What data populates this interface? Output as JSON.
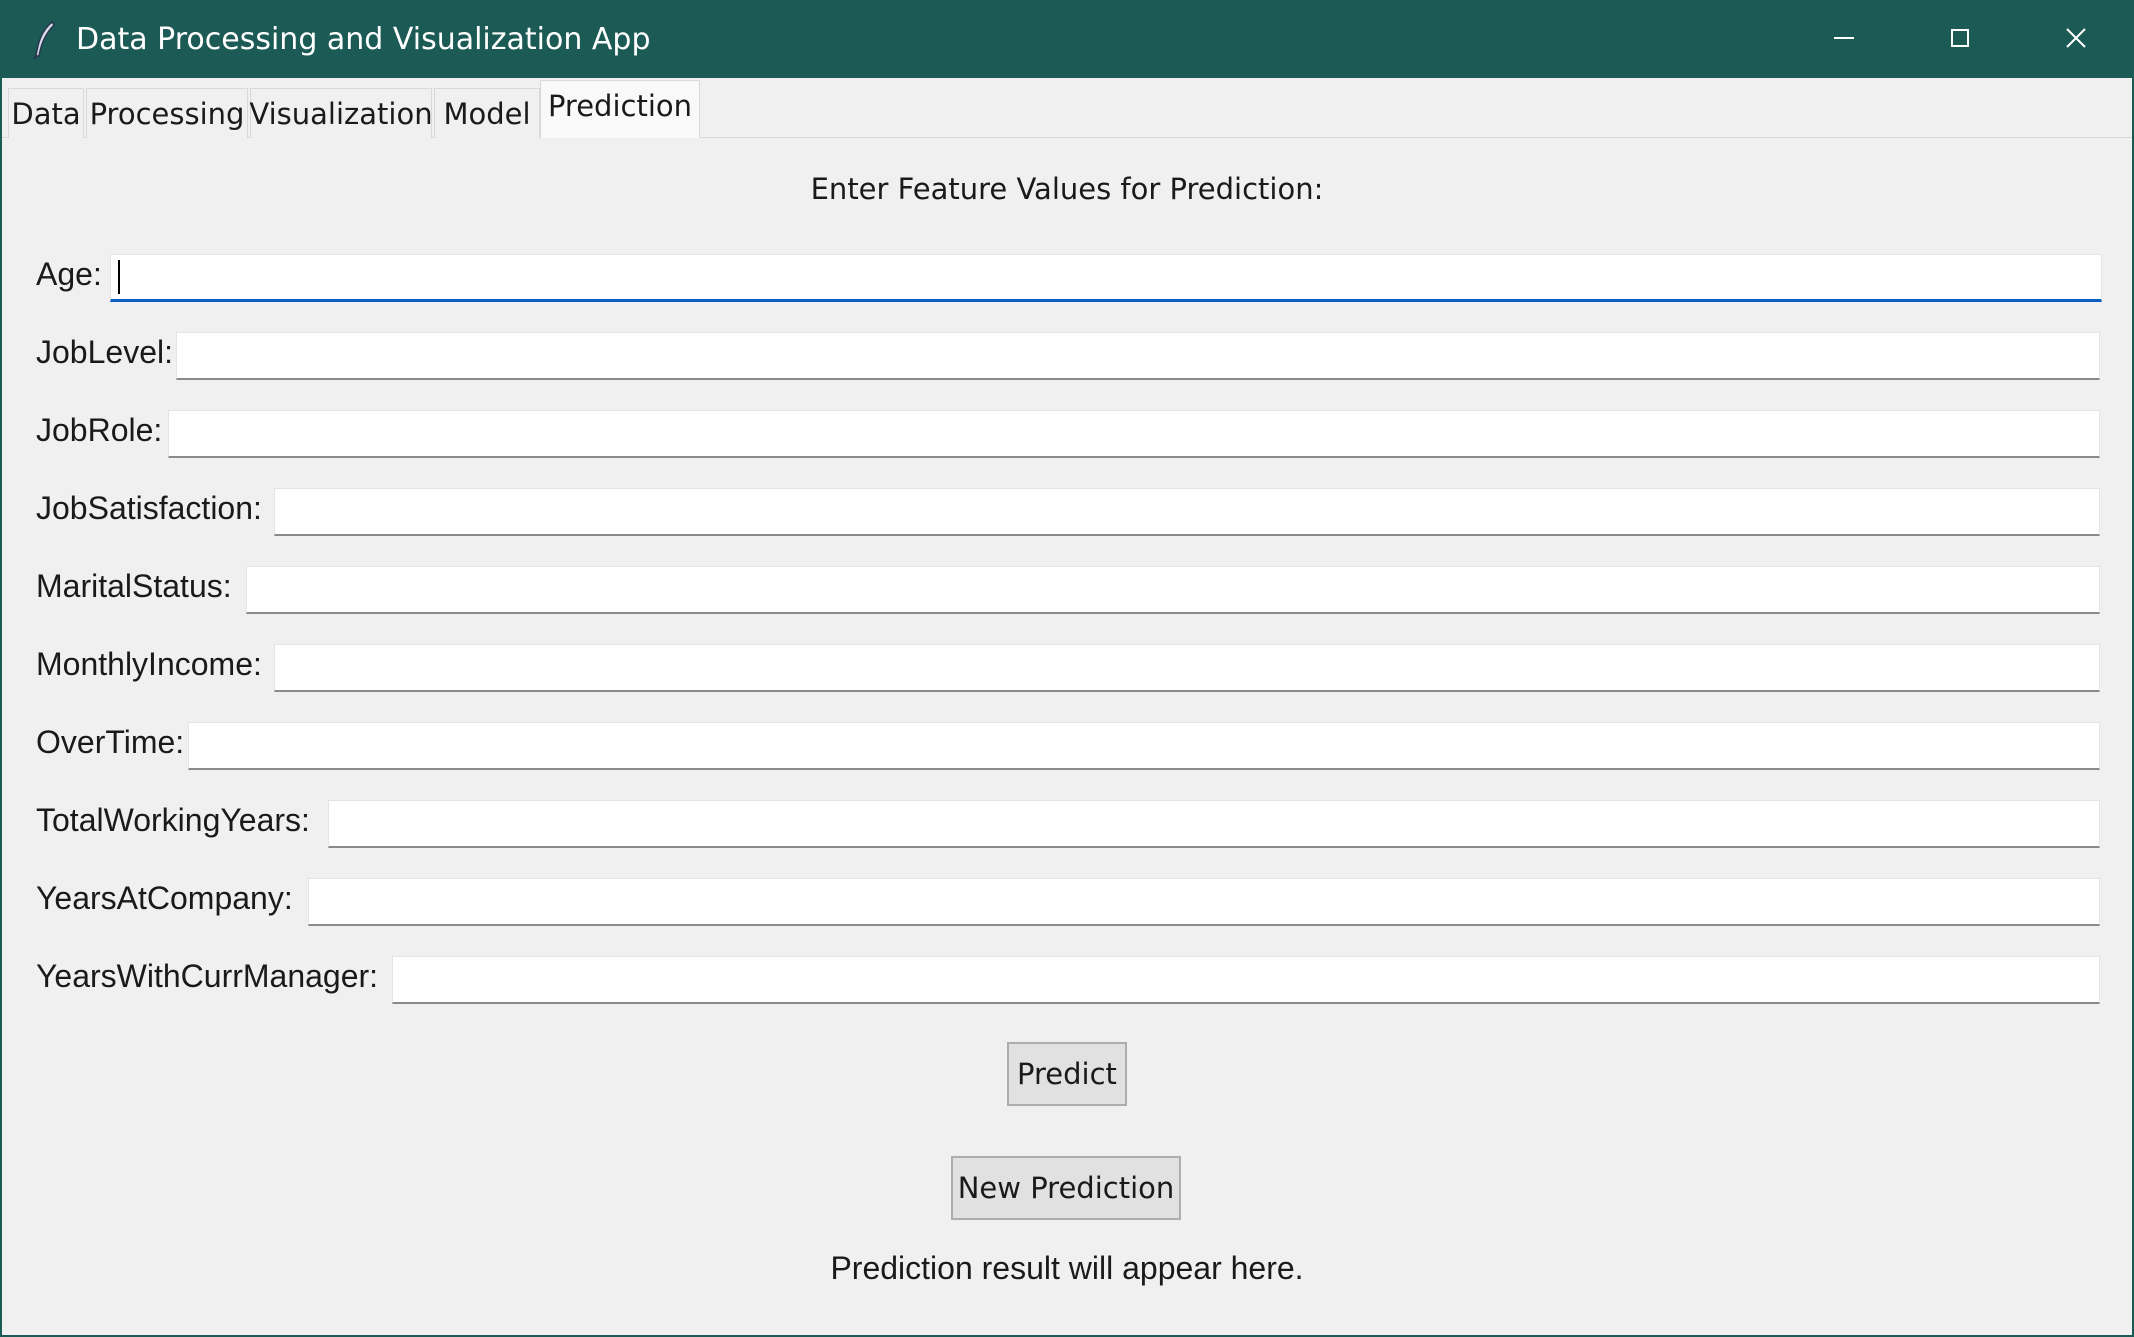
{
  "window": {
    "title": "Data Processing and Visualization App",
    "app_icon": "feather-icon",
    "controls": [
      "minimize-icon",
      "maximize-icon",
      "close-icon"
    ],
    "titlebar_color": "#1b5a55"
  },
  "tabs": [
    {
      "label": "Data",
      "active": false
    },
    {
      "label": "Processing",
      "active": false
    },
    {
      "label": "Visualization",
      "active": false
    },
    {
      "label": "Model",
      "active": false
    },
    {
      "label": "Prediction",
      "active": true
    }
  ],
  "prediction": {
    "heading": "Enter Feature Values for Prediction:",
    "fields": [
      {
        "label": "Age:",
        "value": "",
        "focused": true
      },
      {
        "label": "JobLevel:",
        "value": ""
      },
      {
        "label": "JobRole:",
        "value": ""
      },
      {
        "label": "JobSatisfaction:",
        "value": ""
      },
      {
        "label": "MaritalStatus:",
        "value": ""
      },
      {
        "label": "MonthlyIncome:",
        "value": ""
      },
      {
        "label": "OverTime:",
        "value": ""
      },
      {
        "label": "TotalWorkingYears:",
        "value": ""
      },
      {
        "label": "YearsAtCompany:",
        "value": ""
      },
      {
        "label": "YearsWithCurrManager:",
        "value": ""
      }
    ],
    "predict_button": "Predict",
    "new_prediction_button": "New Prediction",
    "result_text": "Prediction result will appear here.",
    "focus_color": "#0c5fc0"
  }
}
